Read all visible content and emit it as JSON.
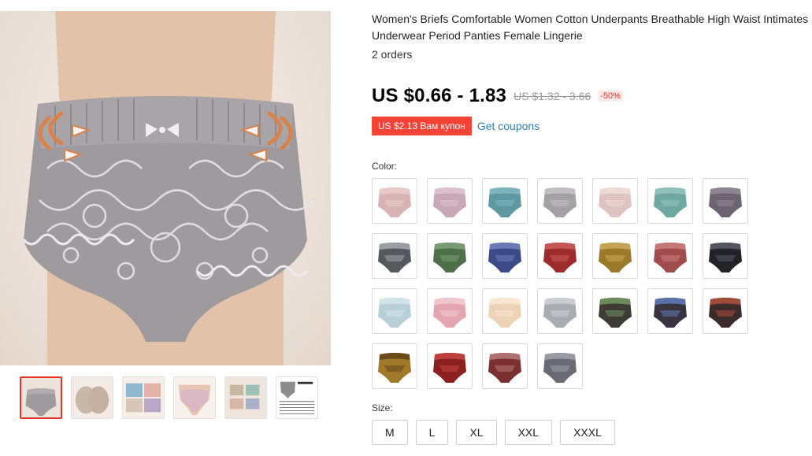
{
  "product": {
    "title": "Women's Briefs Comfortable Women Cotton Underpants Breathable High Waist Intimates Underwear Period Panties Female Lingerie",
    "orders": "2 orders",
    "price": "US $0.66 - 1.83",
    "old_price": "US $1.32 - 3.66",
    "discount": "-50%",
    "coupon": "US $2.13 Вам купон",
    "coupon_link": "Get coupons"
  },
  "color_section": {
    "label": "Color:",
    "swatches": [
      {
        "color": "#d9b3b3",
        "pattern": "#e8c9c9"
      },
      {
        "color": "#c9a8b5",
        "pattern": "#dcc0cc"
      },
      {
        "color": "#5e98a2",
        "pattern": "#7fb3bb"
      },
      {
        "color": "#a3a1a3",
        "pattern": "#c0bec0"
      },
      {
        "color": "#ddc4c0",
        "pattern": "#ecdad6"
      },
      {
        "color": "#6fa8a0",
        "pattern": "#8fc0b9"
      },
      {
        "color": "#6c6470",
        "pattern": "#8c8490"
      },
      {
        "color": "#55585c",
        "pattern": "#9a9ea2"
      },
      {
        "color": "#4f6e4a",
        "pattern": "#7a9a74"
      },
      {
        "color": "#3c4a8a",
        "pattern": "#6a78b4"
      },
      {
        "color": "#9e2b2b",
        "pattern": "#c45555"
      },
      {
        "color": "#9a7a2a",
        "pattern": "#c4a454"
      },
      {
        "color": "#a04c4c",
        "pattern": "#c47878"
      },
      {
        "color": "#222228",
        "pattern": "#55555e"
      },
      {
        "color": "#b7cfd6",
        "pattern": "#d2e3e8"
      },
      {
        "color": "#e3a6b0",
        "pattern": "#f0c6cd"
      },
      {
        "color": "#ecd3b6",
        "pattern": "#f6e6d2"
      },
      {
        "color": "#a9adb1",
        "pattern": "#c9ccd0"
      },
      {
        "color": "#3e3a36",
        "pattern": "#6b8a5a"
      },
      {
        "color": "#3a3440",
        "pattern": "#5a72a8"
      },
      {
        "color": "#3b2b2b",
        "pattern": "#a04a3a"
      },
      {
        "color": "#a07a2a",
        "pattern": "#6a4a1a"
      },
      {
        "color": "#8a2020",
        "pattern": "#c04040"
      },
      {
        "color": "#7a3030",
        "pattern": "#b07070"
      },
      {
        "color": "#6a6a74",
        "pattern": "#9a9aa4"
      }
    ]
  },
  "size_section": {
    "label": "Size:",
    "options": [
      "M",
      "L",
      "XL",
      "XXL",
      "XXXL"
    ]
  },
  "gallery": {
    "main_color": "#9e9a9e",
    "thumbnails": [
      {
        "name": "thumb-grey-front",
        "color": "#9e9a9e"
      },
      {
        "name": "thumb-back-view",
        "color": "#c9b7a8"
      },
      {
        "name": "thumb-color-pack",
        "color": "#8fb7cf"
      },
      {
        "name": "thumb-pink-model",
        "color": "#d9b8c4"
      },
      {
        "name": "thumb-folded-pack",
        "color": "#c7b8a0"
      },
      {
        "name": "thumb-size-chart",
        "color": "#ffffff"
      }
    ]
  },
  "colors": {
    "accent": "#e43225",
    "coupon": "#f44336",
    "link": "#2e7fb8"
  }
}
